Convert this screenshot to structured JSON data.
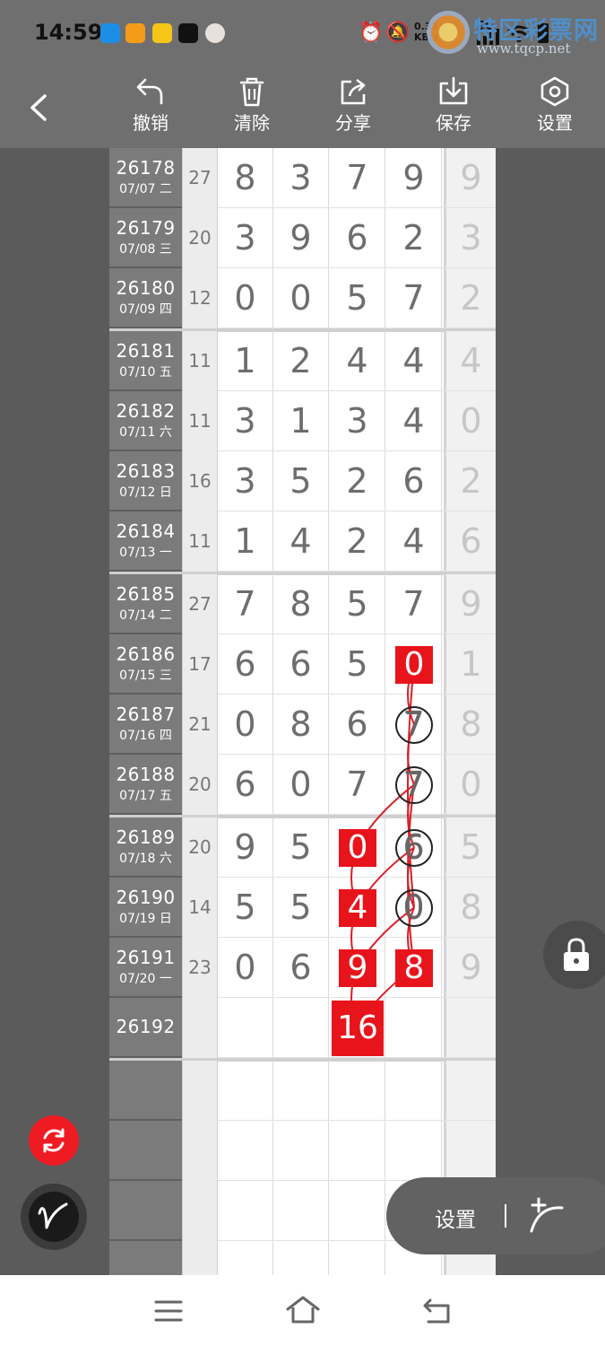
{
  "status_bar": {
    "time": "14:59",
    "net_speed_value": "0.31",
    "net_speed_unit": "KB/s",
    "network": "5G",
    "app_icons": [
      "app-blue-icon",
      "app-orange-icon",
      "app-yellow-icon",
      "tiktok-icon",
      "avatar-icon"
    ],
    "system_icons": [
      "alarm-icon",
      "mute-icon",
      "signal-icon",
      "wifi-icon",
      "battery-icon"
    ]
  },
  "watermark": {
    "text": "特区彩票网",
    "url": "www.tqcp.net"
  },
  "toolbar": {
    "back_icon": "back-arrow-icon",
    "buttons": [
      {
        "label": "撤销",
        "icon": "undo-icon"
      },
      {
        "label": "清除",
        "icon": "trash-icon"
      },
      {
        "label": "分享",
        "icon": "share-icon"
      },
      {
        "label": "保存",
        "icon": "download-icon"
      },
      {
        "label": "设置",
        "icon": "settings-hex-icon"
      }
    ]
  },
  "grid": {
    "rows": [
      {
        "issue": "26178",
        "date": "07/07 二",
        "sum": "27",
        "digits": [
          "8",
          "3",
          "7",
          "9"
        ],
        "extra": "9"
      },
      {
        "issue": "26179",
        "date": "07/08 三",
        "sum": "20",
        "digits": [
          "3",
          "9",
          "6",
          "2"
        ],
        "extra": "3"
      },
      {
        "issue": "26180",
        "date": "07/09 四",
        "sum": "12",
        "digits": [
          "0",
          "0",
          "5",
          "7"
        ],
        "extra": "2"
      },
      {
        "issue": "26181",
        "date": "07/10 五",
        "sum": "11",
        "digits": [
          "1",
          "2",
          "4",
          "4"
        ],
        "extra": "4"
      },
      {
        "issue": "26182",
        "date": "07/11 六",
        "sum": "11",
        "digits": [
          "3",
          "1",
          "3",
          "4"
        ],
        "extra": "0"
      },
      {
        "issue": "26183",
        "date": "07/12 日",
        "sum": "16",
        "digits": [
          "3",
          "5",
          "2",
          "6"
        ],
        "extra": "2"
      },
      {
        "issue": "26184",
        "date": "07/13 一",
        "sum": "11",
        "digits": [
          "1",
          "4",
          "2",
          "4"
        ],
        "extra": "6"
      },
      {
        "issue": "26185",
        "date": "07/14 二",
        "sum": "27",
        "digits": [
          "7",
          "8",
          "5",
          "7"
        ],
        "extra": "9"
      },
      {
        "issue": "26186",
        "date": "07/15 三",
        "sum": "17",
        "digits": [
          "6",
          "6",
          "5",
          "0"
        ],
        "extra": "1"
      },
      {
        "issue": "26187",
        "date": "07/16 四",
        "sum": "21",
        "digits": [
          "0",
          "8",
          "6",
          "7"
        ],
        "extra": "8"
      },
      {
        "issue": "26188",
        "date": "07/17 五",
        "sum": "20",
        "digits": [
          "6",
          "0",
          "7",
          "7"
        ],
        "extra": "0"
      },
      {
        "issue": "26189",
        "date": "07/18 六",
        "sum": "20",
        "digits": [
          "9",
          "5",
          "0",
          "6"
        ],
        "extra": "5"
      },
      {
        "issue": "26190",
        "date": "07/19 日",
        "sum": "14",
        "digits": [
          "5",
          "5",
          "4",
          "0"
        ],
        "extra": "8"
      },
      {
        "issue": "26191",
        "date": "07/20 一",
        "sum": "23",
        "digits": [
          "0",
          "6",
          "9",
          "8"
        ],
        "extra": "9"
      },
      {
        "issue": "26192",
        "date": "",
        "sum": "",
        "digits": [
          "",
          "",
          "",
          ""
        ],
        "extra": ""
      },
      {
        "issue": "",
        "date": "",
        "sum": "",
        "digits": [
          "",
          "",
          "",
          ""
        ],
        "extra": ""
      },
      {
        "issue": "",
        "date": "",
        "sum": "",
        "digits": [
          "",
          "",
          "",
          ""
        ],
        "extra": ""
      },
      {
        "issue": "",
        "date": "",
        "sum": "",
        "digits": [
          "",
          "",
          "",
          ""
        ],
        "extra": ""
      },
      {
        "issue": "",
        "date": "",
        "sum": "",
        "digits": [
          "",
          "",
          "",
          ""
        ],
        "extra": ""
      }
    ],
    "marks": [
      {
        "row": 8,
        "col": 3,
        "style": "red",
        "value": "0"
      },
      {
        "row": 9,
        "col": 3,
        "style": "circle",
        "value": "7"
      },
      {
        "row": 10,
        "col": 3,
        "style": "circle",
        "value": "7"
      },
      {
        "row": 11,
        "col": 2,
        "style": "red",
        "value": "0"
      },
      {
        "row": 11,
        "col": 3,
        "style": "circle",
        "value": "6"
      },
      {
        "row": 12,
        "col": 2,
        "style": "red",
        "value": "4"
      },
      {
        "row": 12,
        "col": 3,
        "style": "circle",
        "value": "0"
      },
      {
        "row": 13,
        "col": 2,
        "style": "red",
        "value": "9"
      },
      {
        "row": 13,
        "col": 3,
        "style": "red",
        "value": "8"
      },
      {
        "row": 14,
        "col": 2,
        "style": "red",
        "value": "16"
      }
    ],
    "mark_color": "#e8141c",
    "curve_color": "#d81e28"
  },
  "floating": {
    "lock_icon": "lock-icon",
    "refresh_icon": "refresh-icon",
    "pen_icon": "pen-signature-icon",
    "settings_label": "设置",
    "draw_icon": "draw-curve-icon"
  },
  "nav_bar": {
    "icons": [
      "menu-icon",
      "home-icon",
      "back-icon"
    ]
  }
}
